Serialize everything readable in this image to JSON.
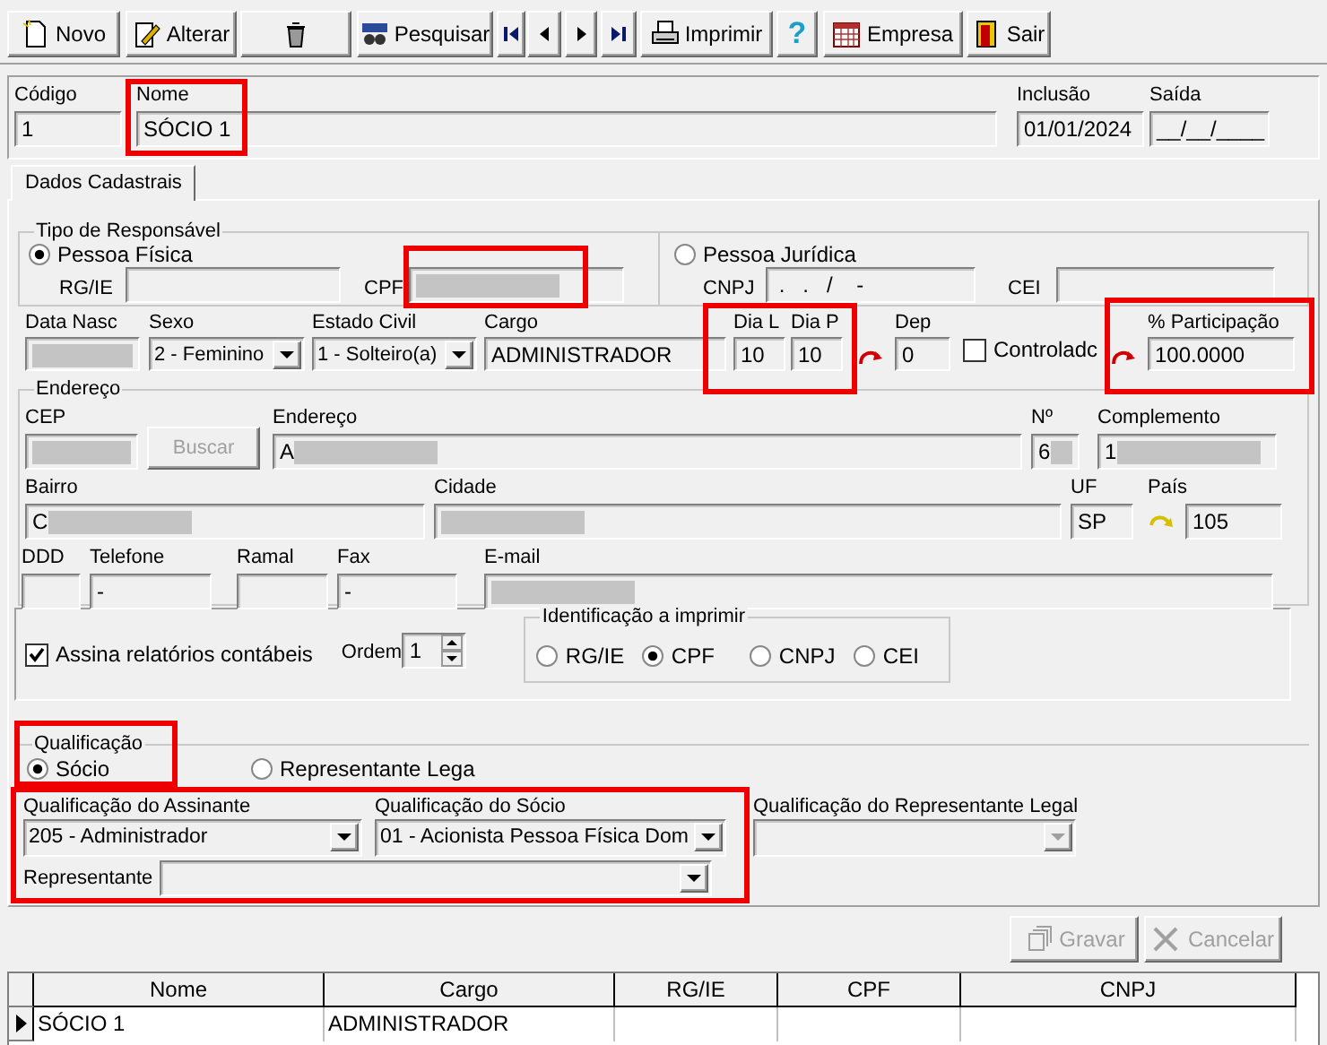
{
  "toolbar": [
    {
      "kind": "text",
      "label": "Novo"
    },
    {
      "kind": "text",
      "label": "Alterar"
    },
    {
      "kind": "icon"
    },
    {
      "kind": "text",
      "label": "Pesquisar"
    },
    {
      "kind": "icon"
    },
    {
      "kind": "icon"
    },
    {
      "kind": "icon"
    },
    {
      "kind": "icon"
    },
    {
      "kind": "text",
      "label": "Imprimir"
    },
    {
      "kind": "glyph",
      "label": "?"
    },
    {
      "kind": "text",
      "label": "Empresa"
    },
    {
      "kind": "text",
      "label": "Sair"
    }
  ],
  "header": [
    {
      "label": "Código",
      "value": "1"
    },
    {
      "label": "Nome",
      "value": "SÓCIO 1",
      "highlighted": true
    },
    {
      "label": "Inclusão",
      "value": "01/01/2024"
    },
    {
      "label": "Saída",
      "value": "__/__/____"
    }
  ],
  "tabs": [
    {
      "label": "Dados Cadastrais",
      "selected": true
    }
  ],
  "tipo_responsavel": {
    "title": "Tipo de Responsável",
    "options": [
      {
        "label": "Pessoa Física",
        "selected": true,
        "fields": [
          {
            "label": "RG/IE"
          },
          {
            "label": "CPF",
            "redacted": true,
            "highlighted": true
          }
        ]
      },
      {
        "label": "Pessoa Jurídica",
        "selected": false,
        "fields": [
          {
            "label": "CNPJ",
            "value": " .   .   /    -"
          },
          {
            "label": "CEI"
          }
        ]
      }
    ]
  },
  "dados": [
    {
      "kind": "field",
      "label": "Data Nasc",
      "redacted": true
    },
    {
      "kind": "combo",
      "label": "Sexo",
      "value": "2 - Feminino"
    },
    {
      "kind": "combo",
      "label": "Estado Civil",
      "value": "1 - Solteiro(a)"
    },
    {
      "kind": "field",
      "label": "Cargo",
      "value": "ADMINISTRADOR"
    },
    {
      "kind": "field",
      "label": "Dia L",
      "value": "10",
      "highlighted": true
    },
    {
      "kind": "field",
      "label": "Dia P",
      "value": "10",
      "highlighted": true
    },
    {
      "kind": "icon"
    },
    {
      "kind": "field",
      "label": "Dep",
      "value": "0"
    },
    {
      "kind": "check",
      "label": "Controladc",
      "checked": false
    },
    {
      "kind": "icon"
    },
    {
      "kind": "field",
      "label": "% Participação",
      "value": "100.0000",
      "highlighted": true
    }
  ],
  "endereco": {
    "title": "Endereço",
    "rows": [
      [
        {
          "kind": "field",
          "label": "CEP",
          "redacted": true
        },
        {
          "kind": "button",
          "label": "Buscar",
          "disabled": true
        },
        {
          "kind": "field",
          "label": "Endereço",
          "value": "A",
          "redacted": true
        },
        {
          "kind": "field",
          "label": "Nº",
          "value": "6",
          "redacted": true
        },
        {
          "kind": "field",
          "label": "Complemento",
          "value": "1",
          "redacted": true
        }
      ],
      [
        {
          "kind": "field",
          "label": "Bairro",
          "value": "C",
          "redacted": true
        },
        {
          "kind": "field",
          "label": "Cidade",
          "redacted": true
        },
        {
          "kind": "field",
          "label": "UF",
          "value": "SP"
        },
        {
          "kind": "icon_field",
          "label": "País",
          "value": "105"
        }
      ],
      [
        {
          "kind": "field",
          "label": "DDD"
        },
        {
          "kind": "field",
          "label": "Telefone",
          "value": "-"
        },
        {
          "kind": "field",
          "label": "Ramal"
        },
        {
          "kind": "field",
          "label": "Fax",
          "value": "-"
        },
        {
          "kind": "field",
          "label": "E-mail",
          "redacted": true
        }
      ]
    ]
  },
  "assina": {
    "checkbox": {
      "label": "Assina relatórios contábeis",
      "checked": true
    },
    "ordem": {
      "label": "Ordem",
      "value": "1"
    },
    "identificacao": {
      "title": "Identificação a imprimir",
      "options": [
        {
          "label": "RG/IE",
          "selected": false
        },
        {
          "label": "CPF",
          "selected": true
        },
        {
          "label": "CNPJ",
          "selected": false
        },
        {
          "label": "CEI",
          "selected": false
        }
      ]
    }
  },
  "qualificacao": {
    "title": "Qualificação",
    "highlighted": true,
    "options": [
      {
        "label": "Sócio",
        "selected": true
      },
      {
        "label": "Representante Lega",
        "selected": false
      }
    ],
    "selects_highlighted": true,
    "selects": [
      {
        "label": "Qualificação do Assinante",
        "value": "205 - Administrador",
        "disabled": false
      },
      {
        "label": "Qualificação do Sócio",
        "value": "01 - Acionista Pessoa Física Dom",
        "disabled": false
      },
      {
        "label": "Qualificação do Representante Legal",
        "disabled": true
      }
    ],
    "representante": {
      "label": "Representante"
    }
  },
  "actions": [
    {
      "label": "Gravar",
      "disabled": true
    },
    {
      "label": "Cancelar",
      "disabled": true
    }
  ],
  "table": {
    "columns": [
      "Nome",
      "Cargo",
      "RG/IE",
      "CPF",
      "CNPJ"
    ],
    "rows": [
      {
        "selected": true,
        "cells": [
          "SÓCIO 1",
          "ADMINISTRADOR"
        ]
      }
    ]
  }
}
